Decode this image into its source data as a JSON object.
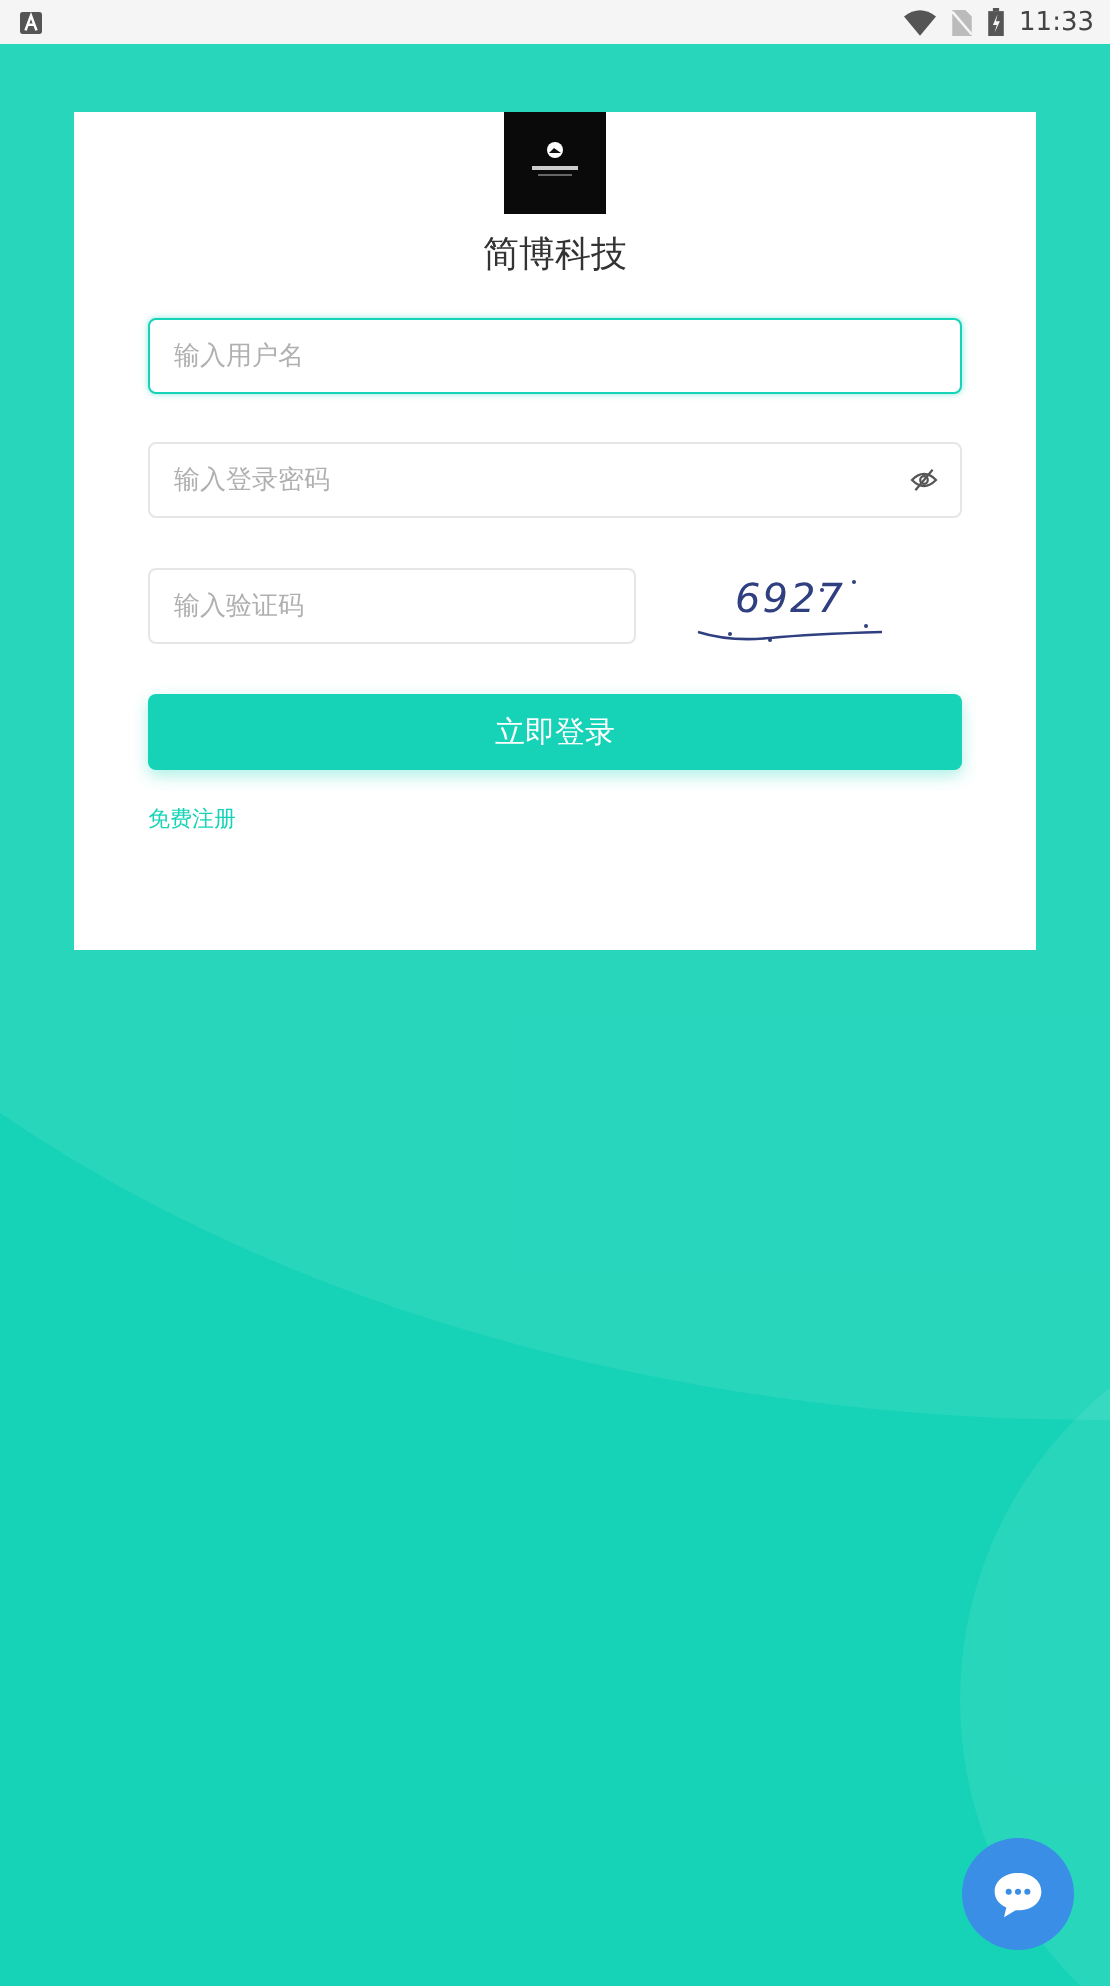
{
  "status_bar": {
    "time": "11:33"
  },
  "brand": {
    "title": "简博科技"
  },
  "fields": [
    {
      "kind": "text",
      "placeholder": "输入用户名",
      "focused": true
    },
    {
      "kind": "password",
      "placeholder": "输入登录密码",
      "focused": false
    }
  ],
  "captcha": {
    "placeholder": "输入验证码",
    "code": "6927"
  },
  "login_button": "立即登录",
  "register_link": "免费注册"
}
